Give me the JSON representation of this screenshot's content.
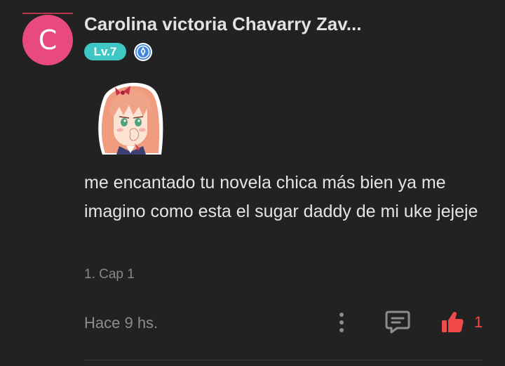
{
  "comment": {
    "avatar_letter": "C",
    "avatar_color": "#e84a7d",
    "username": "Carolina victoria Chavarry Zav...",
    "level": "Lv.7",
    "level_color": "#3ec7c4",
    "badge_icon": "writer-badge-icon",
    "sticker": "anime-girl-sticker",
    "text": "me encantado tu novela chica más bien ya me imagino como esta el sugar daddy de mi uke jejeje",
    "chapter_ref": "1. Cap 1",
    "timestamp": "Hace 9 hs.",
    "like_count": "1",
    "like_color": "#f04a4a"
  }
}
